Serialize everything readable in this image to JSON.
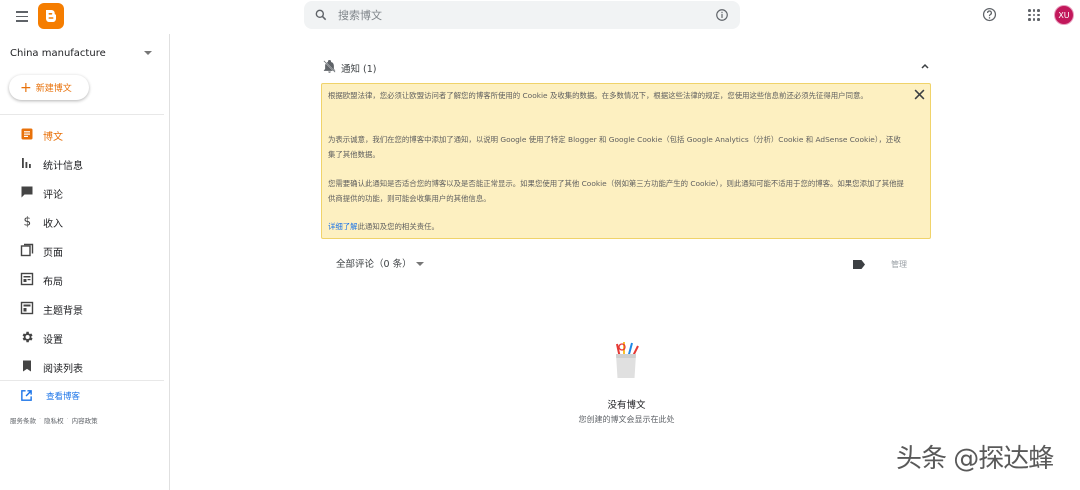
{
  "topbar": {
    "search_placeholder": "搜索博文",
    "avatar_initials": "XU"
  },
  "sidebar": {
    "blog_name": "China manufacture",
    "new_post_label": "新建博文",
    "items": [
      {
        "label": "博文",
        "icon": "posts-icon",
        "active": true
      },
      {
        "label": "统计信息",
        "icon": "stats-icon"
      },
      {
        "label": "评论",
        "icon": "comments-icon"
      },
      {
        "label": "收入",
        "icon": "dollar-icon"
      },
      {
        "label": "页面",
        "icon": "pages-icon"
      },
      {
        "label": "布局",
        "icon": "layout-icon"
      },
      {
        "label": "主题背景",
        "icon": "theme-icon"
      },
      {
        "label": "设置",
        "icon": "gear-icon"
      },
      {
        "label": "阅读列表",
        "icon": "bookmark-icon"
      }
    ],
    "view_blog_label": "查看博客",
    "footer": [
      "服务条款",
      "隐私权",
      "内容政策"
    ]
  },
  "notice": {
    "title": "通知 (1)",
    "p1": "根据欧盟法律，您必须让欧盟访问者了解您的博客所使用的 Cookie 及收集的数据。在多数情况下，根据这些法律的规定，您使用这些信息前还必须先征得用户同意。",
    "p2": "为表示诚意，我们在您的博客中添加了通知，以说明 Google 使用了特定 Blogger 和 Google Cookie（包括 Google Analytics（分析）Cookie 和 AdSense Cookie），还收集了其他数据。",
    "p3": "您需要确认此通知是否适合您的博客以及是否能正常显示。如果您使用了其他 Cookie（例如第三方功能产生的 Cookie），则此通知可能不适用于您的博客。如果您添加了其他提供商提供的功能，则可能会收集用户的其他信息。",
    "learn_more_link": "详细了解",
    "learn_more_rest": "此通知及您的相关责任。"
  },
  "main": {
    "filter_label": "全部评论（0 条）",
    "manage_label": "管理",
    "empty_title": "没有博文",
    "empty_subtitle": "您创建的博文会显示在此处"
  },
  "watermark": "头条 @探达蜂",
  "colors": {
    "accent": "#e8710a",
    "link": "#1a73e8",
    "notice_bg": "#fdf0c1",
    "logo": "#f57d00",
    "avatar": "#c2185b"
  }
}
